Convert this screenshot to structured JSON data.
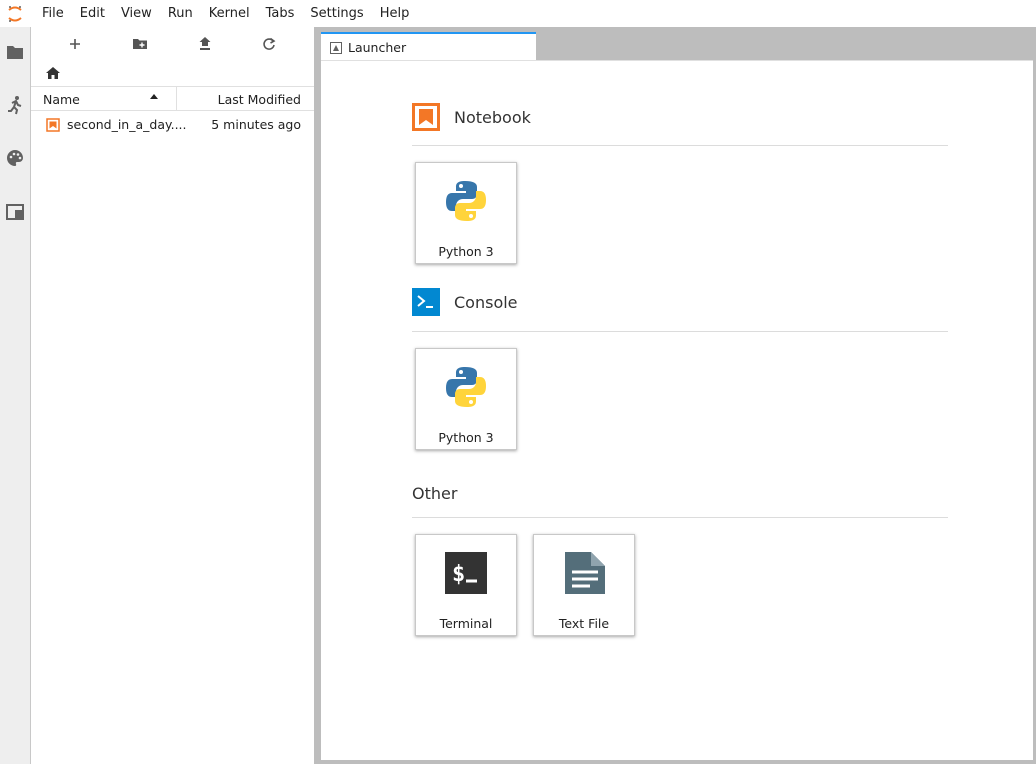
{
  "menubar": {
    "items": [
      "File",
      "Edit",
      "View",
      "Run",
      "Kernel",
      "Tabs",
      "Settings",
      "Help"
    ]
  },
  "filebrowser": {
    "columns": {
      "name": "Name",
      "modified": "Last Modified"
    },
    "files": [
      {
        "name": "second_in_a_day....",
        "modified": "5 minutes ago",
        "icon": "notebook-icon"
      }
    ]
  },
  "tabs": [
    {
      "label": "Launcher",
      "icon": "launcher-icon",
      "active": true
    }
  ],
  "launcher": {
    "sections": [
      {
        "title": "Notebook",
        "icon": "notebook-icon",
        "cards": [
          {
            "label": "Python 3",
            "icon": "python-icon"
          }
        ]
      },
      {
        "title": "Console",
        "icon": "console-icon",
        "cards": [
          {
            "label": "Python 3",
            "icon": "python-icon"
          }
        ]
      },
      {
        "title": "Other",
        "icon": "",
        "cards": [
          {
            "label": "Terminal",
            "icon": "terminal-icon"
          },
          {
            "label": "Text File",
            "icon": "text-file-icon"
          }
        ]
      }
    ]
  },
  "colors": {
    "accent": "#2196f3",
    "notebook_orange": "#f37726",
    "console_blue": "#0288d1",
    "python_blue": "#3776ab",
    "python_yellow": "#ffd43b",
    "terminal_bg": "#333333",
    "textfile_gray": "#546e7a"
  }
}
